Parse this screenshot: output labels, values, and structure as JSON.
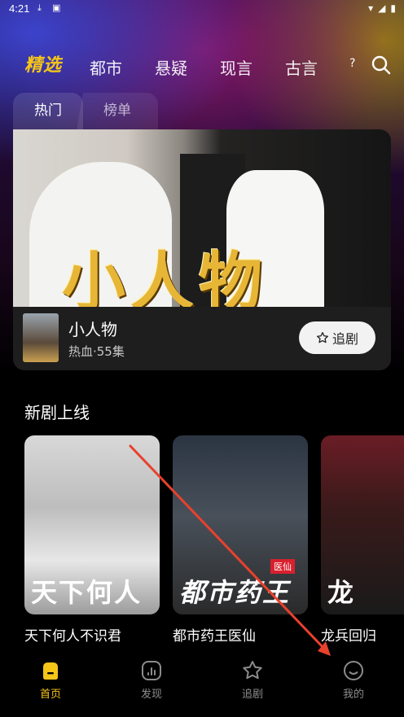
{
  "status_bar": {
    "time": "4:21",
    "icons": [
      "download-icon",
      "a-icon",
      "wifi-icon",
      "signal-icon",
      "battery-icon"
    ]
  },
  "nav": {
    "featured_label": "精选",
    "tabs": [
      "都市",
      "悬疑",
      "现言",
      "古言"
    ],
    "more_label": "?"
  },
  "sub_tabs": {
    "hot_label": "热门",
    "rank_label": "榜单"
  },
  "banner": {
    "poster_title": "小人物",
    "name": "小人物",
    "meta": "热血·55集",
    "follow_label": "追剧"
  },
  "new_section": {
    "title": "新剧上线",
    "dramas": [
      {
        "name": "天下何人不识君",
        "cover_text": "天下何人"
      },
      {
        "name": "都市药王医仙",
        "cover_text": "都市药王",
        "badge": "医仙"
      },
      {
        "name": "龙兵回归",
        "cover_text": "龙"
      }
    ]
  },
  "tab_bar": {
    "items": [
      {
        "label": "首页",
        "icon": "home-icon",
        "active": true
      },
      {
        "label": "发现",
        "icon": "discover-icon",
        "active": false
      },
      {
        "label": "追剧",
        "icon": "star-icon",
        "active": false
      },
      {
        "label": "我的",
        "icon": "profile-icon",
        "active": false
      }
    ]
  },
  "colors": {
    "accent": "#f5c518",
    "active_tab": "#f5c518",
    "inactive_tab": "#8c8c8c",
    "annotation_arrow": "#e8412c"
  }
}
